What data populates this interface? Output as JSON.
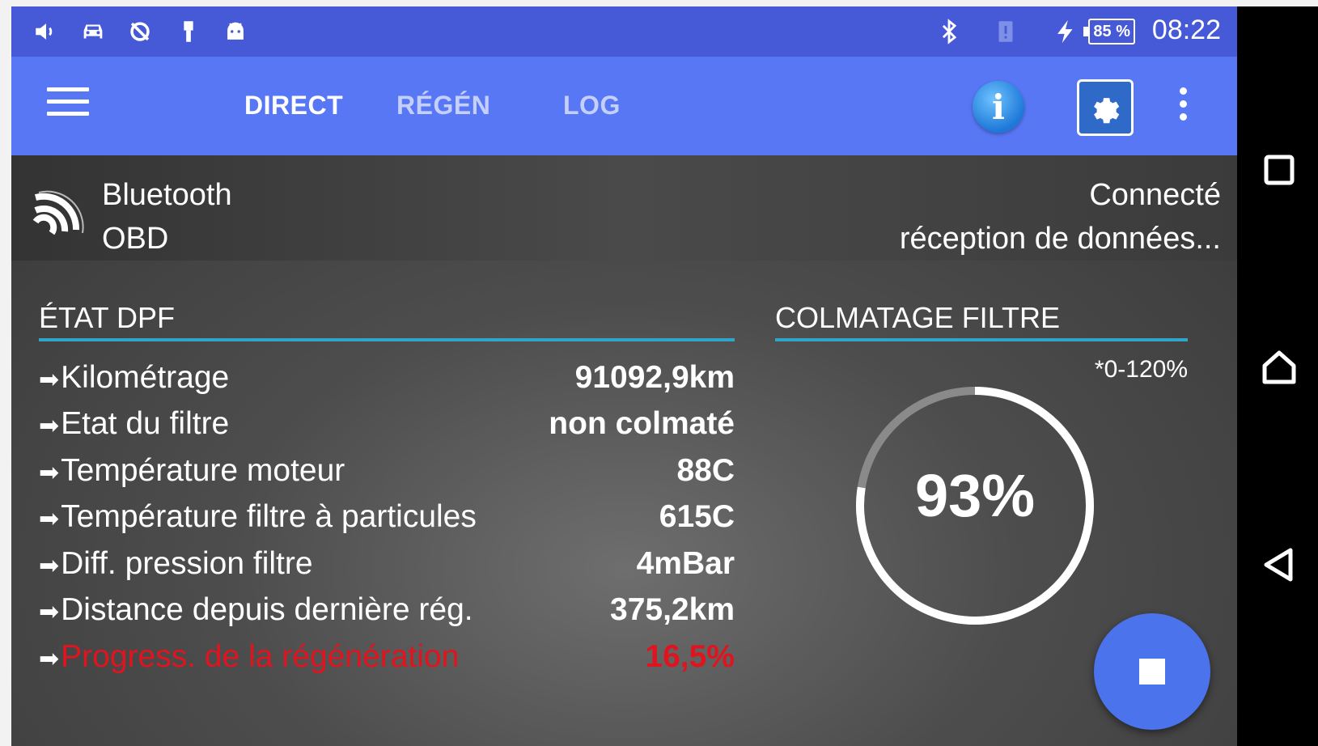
{
  "status_bar": {
    "left_icons": [
      "volume-icon",
      "car-icon",
      "sync-off-icon",
      "usb-icon",
      "android-icon"
    ],
    "right_icons": [
      "bluetooth-icon",
      "alert-icon",
      "charging-icon"
    ],
    "battery": "85 %",
    "time": "08:22"
  },
  "toolbar": {
    "tabs": [
      {
        "label": "DIRECT",
        "active": true
      },
      {
        "label": "RÉGÉN",
        "active": false
      },
      {
        "label": "LOG",
        "active": false
      }
    ],
    "info_icon": "i"
  },
  "connection": {
    "type_line1": "Bluetooth",
    "type_line2": "OBD",
    "status_line1": "Connecté",
    "status_line2": "réception de données..."
  },
  "dpf": {
    "title": "ÉTAT DPF",
    "rows": [
      {
        "label": "Kilométrage",
        "value": "91092,9km"
      },
      {
        "label": "Etat du filtre",
        "value": "non colmaté"
      },
      {
        "label": "Température moteur",
        "value": "88C"
      },
      {
        "label": "Température filtre à particules",
        "value": "615C"
      },
      {
        "label": "Diff. pression filtre",
        "value": "4mBar"
      },
      {
        "label": "Distance depuis dernière rég.",
        "value": "375,2km"
      },
      {
        "label": "Progress. de la régénération",
        "value": "16,5%"
      }
    ],
    "arrow": "➡"
  },
  "clogging": {
    "title": "COLMATAGE FILTRE",
    "range_note": "*0-120%",
    "value_text": "93%",
    "value": 93,
    "max": 120,
    "colors": {
      "fill": "#ffffff",
      "track": "#8a8a8a"
    }
  },
  "colors": {
    "status_bar": "#4659d6",
    "toolbar": "#5877f4",
    "accent_line": "#2fa6c7",
    "warning": "#e0141e",
    "fab": "#4a73ec"
  },
  "nav": [
    "recents-icon",
    "home-icon",
    "back-icon"
  ]
}
